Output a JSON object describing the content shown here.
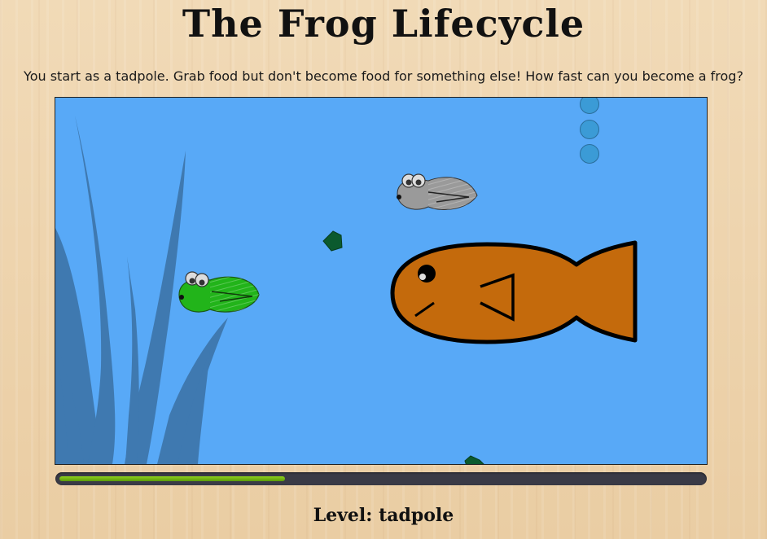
{
  "header": {
    "title": "The Frog Lifecycle",
    "instructions": "You start as a tadpole. Grab food but don't become food for something else! How fast can you become a frog?"
  },
  "game": {
    "water_color": "#58a9f7",
    "weed_color": "#3f79b0",
    "player": {
      "sprite": "tadpole-icon",
      "color": "#22b41a"
    },
    "rival": {
      "sprite": "tadpole-icon",
      "color": "#9a9a9a"
    },
    "predator": {
      "sprite": "fish-icon",
      "color": "#c46a0c"
    },
    "food_color": "#0b5a2e",
    "bubble_color": "#3b9bd6"
  },
  "progress": {
    "fraction": 0.35,
    "color": "#7dc114"
  },
  "level": {
    "label": "Level: tadpole"
  }
}
